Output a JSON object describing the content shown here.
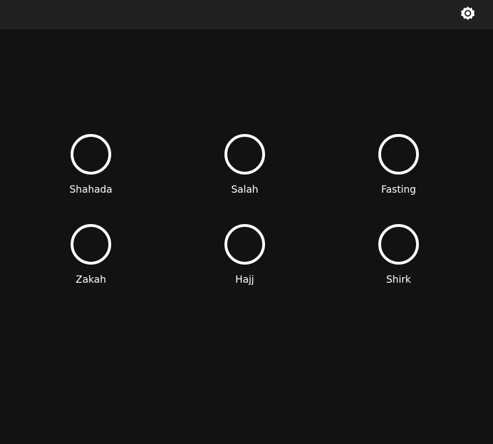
{
  "header": {
    "settings_icon": "gear-icon"
  },
  "items": [
    {
      "label": "Shahada"
    },
    {
      "label": "Salah"
    },
    {
      "label": "Fasting"
    },
    {
      "label": "Zakah"
    },
    {
      "label": "Hajj"
    },
    {
      "label": "Shirk"
    }
  ]
}
